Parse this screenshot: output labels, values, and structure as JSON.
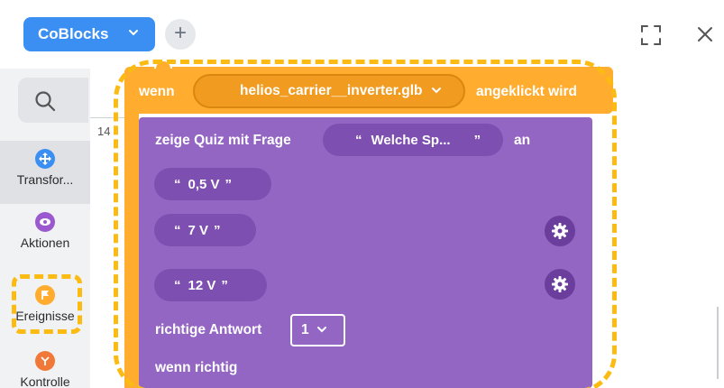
{
  "topbar": {
    "project_label": "CoBlocks",
    "add_label": "+"
  },
  "sidebar": {
    "items": [
      {
        "label": "Transfor...",
        "icon": "transform-icon",
        "color": "#3b8ff2"
      },
      {
        "label": "Aktionen",
        "icon": "eye-icon",
        "color": "#9b59d0"
      },
      {
        "label": "Ereignisse",
        "icon": "flag-icon",
        "color": "#ffac2f"
      },
      {
        "label": "Kontrolle",
        "icon": "branch-icon",
        "color": "#f0793a"
      }
    ]
  },
  "workspace": {
    "ruler_number": "14"
  },
  "event_block": {
    "prefix": "wenn",
    "model": "helios_carrier__inverter.glb",
    "suffix": "angeklickt wird",
    "color": "#ffac2f"
  },
  "quiz_block": {
    "prefix": "zeige Quiz mit Frage",
    "question": "Welche Sp...",
    "suffix": "an",
    "answers": [
      "0,5 V",
      "7 V",
      "12 V"
    ],
    "correct_label": "richtige Antwort",
    "correct_value": "1",
    "if_correct_label": "wenn richtig",
    "color": "#9466c4"
  },
  "quote": "“",
  "quote_close": "”",
  "highlight_color": "#fbbb12"
}
